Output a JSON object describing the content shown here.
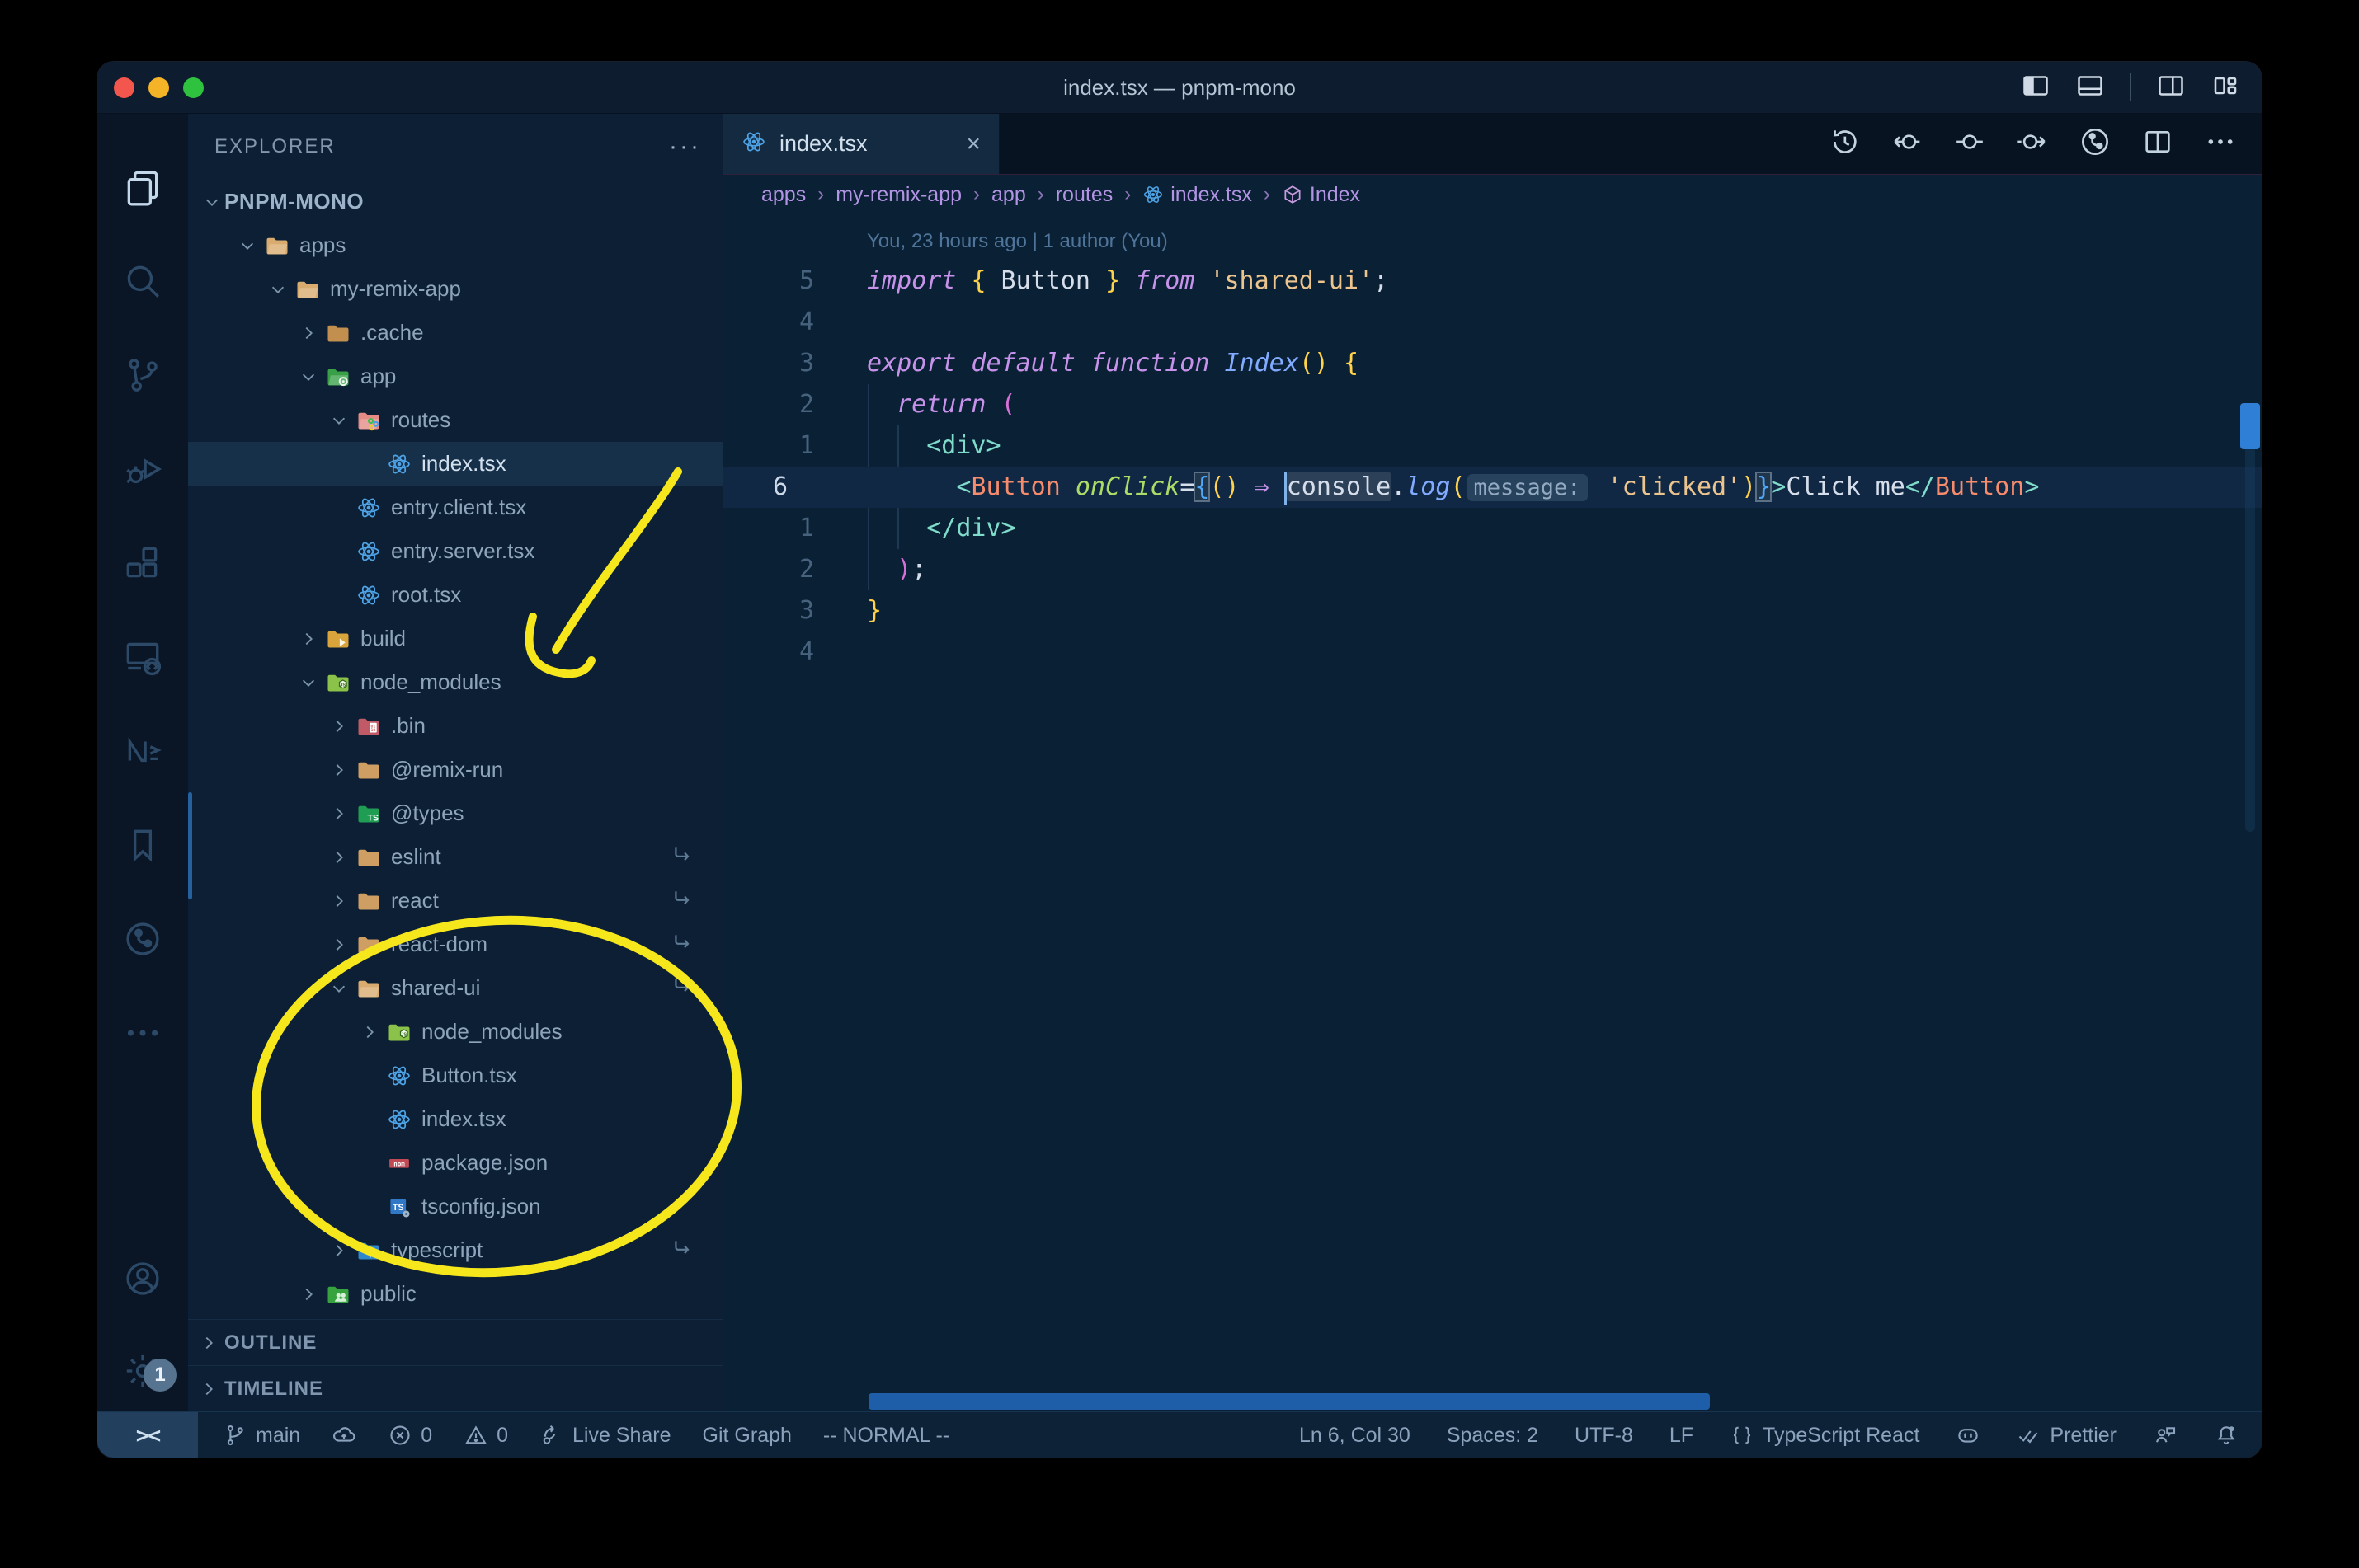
{
  "window": {
    "title": "index.tsx — pnpm-mono"
  },
  "colors": {
    "annotation_yellow": "#f6e71d",
    "traffic": [
      "#f2564d",
      "#f5b428",
      "#2fc23f"
    ],
    "syntax": {
      "kw": {
        "color": "#c792ea",
        "italic": true
      },
      "fn": {
        "color": "#82aaff",
        "italic": true
      },
      "comp": {
        "color": "#f78c6c"
      },
      "tag": {
        "color": "#7fdbca"
      },
      "attr": {
        "color": "#addb67",
        "italic": true
      },
      "str": {
        "color": "#ecc48d"
      },
      "var": {
        "color": "#d6deeb"
      },
      "txt": {
        "color": "#d6deeb"
      },
      "op": {
        "color": "#c792ea"
      },
      "b1": {
        "color": "#ffd24a"
      },
      "b2": {
        "color": "#d670d6"
      },
      "b3": {
        "color": "#4fa7f7"
      }
    }
  },
  "activity_bar": {
    "items": [
      {
        "icon": "files",
        "name": "explorer",
        "active": true
      },
      {
        "icon": "search",
        "name": "search"
      },
      {
        "icon": "scm",
        "name": "source-control"
      },
      {
        "icon": "debug",
        "name": "run-and-debug"
      },
      {
        "icon": "extensions",
        "name": "extensions"
      },
      {
        "icon": "remote",
        "name": "remote-explorer"
      },
      {
        "icon": "nx",
        "name": "nx-console"
      },
      {
        "icon": "bookmark",
        "name": "bookmarks"
      },
      {
        "icon": "gitgraph",
        "name": "git-graph"
      },
      {
        "icon": "more",
        "name": "additional-views"
      }
    ],
    "bottom": [
      {
        "icon": "account",
        "name": "accounts"
      },
      {
        "icon": "gear",
        "name": "settings",
        "badge": "1"
      }
    ]
  },
  "explorer": {
    "header": "EXPLORER",
    "header_more": "···",
    "root": "PNPM-MONO",
    "items": [
      {
        "label": "apps",
        "level": 1,
        "icon": "folder-open-tan",
        "chevron": "open"
      },
      {
        "label": "my-remix-app",
        "level": 2,
        "icon": "folder-open-tan",
        "chevron": "open"
      },
      {
        "label": ".cache",
        "level": 3,
        "icon": "folder-cache",
        "chevron": "closed"
      },
      {
        "label": "app",
        "level": 3,
        "icon": "folder-app",
        "chevron": "open"
      },
      {
        "label": "routes",
        "level": 4,
        "icon": "folder-routes",
        "chevron": "open"
      },
      {
        "label": "index.tsx",
        "level": 5,
        "icon": "react",
        "selected": true
      },
      {
        "label": "entry.client.tsx",
        "level": 4,
        "icon": "react"
      },
      {
        "label": "entry.server.tsx",
        "level": 4,
        "icon": "react"
      },
      {
        "label": "root.tsx",
        "level": 4,
        "icon": "react"
      },
      {
        "label": "build",
        "level": 3,
        "icon": "folder-build",
        "chevron": "closed"
      },
      {
        "label": "node_modules",
        "level": 3,
        "icon": "folder-nm",
        "chevron": "open"
      },
      {
        "label": ".bin",
        "level": 4,
        "icon": "folder-bin",
        "chevron": "closed"
      },
      {
        "label": "@remix-run",
        "level": 4,
        "icon": "folder-tan",
        "chevron": "closed"
      },
      {
        "label": "@types",
        "level": 4,
        "icon": "folder-types",
        "chevron": "closed"
      },
      {
        "label": "eslint",
        "level": 4,
        "icon": "folder-tan",
        "chevron": "closed",
        "symlink": true
      },
      {
        "label": "react",
        "level": 4,
        "icon": "folder-tan",
        "chevron": "closed",
        "symlink": true
      },
      {
        "label": "react-dom",
        "level": 4,
        "icon": "folder-tan",
        "chevron": "closed",
        "symlink": true
      },
      {
        "label": "shared-ui",
        "level": 4,
        "icon": "folder-open-tan",
        "chevron": "open",
        "symlink": true
      },
      {
        "label": "node_modules",
        "level": 5,
        "icon": "folder-nm",
        "chevron": "closed"
      },
      {
        "label": "Button.tsx",
        "level": 5,
        "icon": "react"
      },
      {
        "label": "index.tsx",
        "level": 5,
        "icon": "react"
      },
      {
        "label": "package.json",
        "level": 5,
        "icon": "npm"
      },
      {
        "label": "tsconfig.json",
        "level": 5,
        "icon": "tsconfig"
      },
      {
        "label": "typescript",
        "level": 4,
        "icon": "folder-ts",
        "chevron": "closed",
        "symlink": true
      },
      {
        "label": "public",
        "level": 3,
        "icon": "folder-public",
        "chevron": "closed"
      }
    ],
    "sections": [
      "OUTLINE",
      "TIMELINE"
    ]
  },
  "tabs": {
    "active_label": "index.tsx",
    "close": "×"
  },
  "editor_actions": [
    "history",
    "gl-prev",
    "gl-open",
    "gl-next",
    "gl-branch",
    "split",
    "more"
  ],
  "window_icons": [
    "layout-sidebar-left",
    "layout-panel",
    "sep",
    "layout-sidebar-right2",
    "layout-custom"
  ],
  "breadcrumbs": [
    {
      "label": "apps"
    },
    {
      "label": "my-remix-app"
    },
    {
      "label": "app"
    },
    {
      "label": "routes"
    },
    {
      "label": "index.tsx",
      "icon": "react"
    },
    {
      "label": "Index",
      "icon": "cube"
    }
  ],
  "code": {
    "blame": "You, 23 hours ago | 1 author (You)",
    "lines": [
      {
        "num": "5",
        "tokens": [
          {
            "t": "import",
            "s": "kw"
          },
          {
            "t": " ",
            "s": "txt"
          },
          {
            "t": "{",
            "s": "b1"
          },
          {
            "t": " Button ",
            "s": "var"
          },
          {
            "t": "}",
            "s": "b1"
          },
          {
            "t": " ",
            "s": "txt"
          },
          {
            "t": "from",
            "s": "kw"
          },
          {
            "t": " ",
            "s": "txt"
          },
          {
            "t": "'shared-ui'",
            "s": "str"
          },
          {
            "t": ";",
            "s": "txt"
          }
        ]
      },
      {
        "num": "4",
        "tokens": []
      },
      {
        "num": "3",
        "tokens": [
          {
            "t": "export",
            "s": "kw"
          },
          {
            "t": " ",
            "s": "txt"
          },
          {
            "t": "default",
            "s": "kw"
          },
          {
            "t": " ",
            "s": "txt"
          },
          {
            "t": "function",
            "s": "kw"
          },
          {
            "t": " ",
            "s": "txt"
          },
          {
            "t": "Index",
            "s": "fn"
          },
          {
            "t": "()",
            "s": "b1"
          },
          {
            "t": " ",
            "s": "txt"
          },
          {
            "t": "{",
            "s": "b1"
          }
        ]
      },
      {
        "num": "2",
        "tokens": [
          {
            "t": "  ",
            "s": "txt"
          },
          {
            "t": "return",
            "s": "kw"
          },
          {
            "t": " ",
            "s": "txt"
          },
          {
            "t": "(",
            "s": "b2"
          }
        ]
      },
      {
        "num": "1",
        "tokens": [
          {
            "t": "    ",
            "s": "txt"
          },
          {
            "t": "<div>",
            "s": "tag"
          }
        ]
      },
      {
        "num": "6",
        "current": true,
        "tokens": [
          {
            "t": "      ",
            "s": "txt"
          },
          {
            "t": "<",
            "s": "tag"
          },
          {
            "t": "Button",
            "s": "comp"
          },
          {
            "t": " ",
            "s": "txt"
          },
          {
            "t": "onClick",
            "s": "attr"
          },
          {
            "t": "=",
            "s": "txt"
          },
          {
            "t": "{",
            "s": "b3",
            "box": true
          },
          {
            "t": "()",
            "s": "b1"
          },
          {
            "t": " ",
            "s": "txt"
          },
          {
            "t": "⇒",
            "s": "op"
          },
          {
            "t": " ",
            "s": "txt"
          },
          {
            "t": "",
            "cursor": true
          },
          {
            "t": "console",
            "s": "var",
            "bg": true
          },
          {
            "t": ".",
            "s": "txt"
          },
          {
            "t": "log",
            "s": "fn"
          },
          {
            "t": "(",
            "s": "b1"
          },
          {
            "t": "message:",
            "hint": true
          },
          {
            "t": " ",
            "s": "txt"
          },
          {
            "t": "'clicked'",
            "s": "str"
          },
          {
            "t": ")",
            "s": "b1"
          },
          {
            "t": "}",
            "s": "b3",
            "box": true
          },
          {
            "t": ">",
            "s": "tag"
          },
          {
            "t": "Click me",
            "s": "var"
          },
          {
            "t": "</",
            "s": "tag"
          },
          {
            "t": "Button",
            "s": "comp"
          },
          {
            "t": ">",
            "s": "tag"
          }
        ]
      },
      {
        "num": "1",
        "tokens": [
          {
            "t": "    ",
            "s": "txt"
          },
          {
            "t": "</div>",
            "s": "tag"
          }
        ]
      },
      {
        "num": "2",
        "tokens": [
          {
            "t": "  ",
            "s": "txt"
          },
          {
            "t": ")",
            "s": "b2"
          },
          {
            "t": ";",
            "s": "txt"
          }
        ]
      },
      {
        "num": "3",
        "tokens": [
          {
            "t": "}",
            "s": "b1"
          }
        ]
      },
      {
        "num": "4",
        "tokens": []
      }
    ]
  },
  "status_bar": {
    "remote": "><",
    "left": [
      {
        "icon": "branch",
        "label": "main",
        "name": "git-branch"
      },
      {
        "icon": "cloud",
        "label": "",
        "name": "publish"
      },
      {
        "icon": "error",
        "label": "0",
        "name": "errors"
      },
      {
        "icon": "warn",
        "label": "0",
        "name": "warnings"
      },
      {
        "icon": "liveshare",
        "label": "Live Share",
        "name": "live-share"
      },
      {
        "icon": "",
        "label": "Git Graph",
        "name": "git-graph"
      },
      {
        "icon": "",
        "label": "-- NORMAL --",
        "name": "vim-mode"
      }
    ],
    "right": [
      {
        "icon": "",
        "label": "Ln 6, Col 30",
        "name": "cursor-position"
      },
      {
        "icon": "",
        "label": "Spaces: 2",
        "name": "indentation"
      },
      {
        "icon": "",
        "label": "UTF-8",
        "name": "encoding"
      },
      {
        "icon": "",
        "label": "LF",
        "name": "eol"
      },
      {
        "icon": "braces",
        "label": "TypeScript React",
        "name": "language-mode"
      },
      {
        "icon": "copilot",
        "label": "",
        "name": "copilot"
      },
      {
        "icon": "dblcheck",
        "label": "Prettier",
        "name": "prettier"
      },
      {
        "icon": "feedback",
        "label": "",
        "name": "feedback"
      },
      {
        "icon": "bell",
        "label": "",
        "name": "notifications"
      }
    ]
  }
}
